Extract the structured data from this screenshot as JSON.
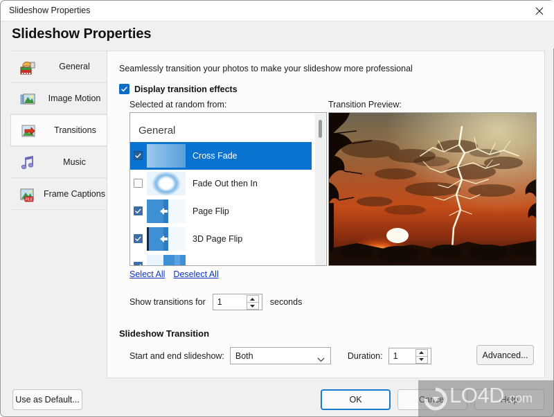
{
  "window": {
    "title": "Slideshow Properties",
    "close_icon": "close-icon"
  },
  "header": {
    "page_title": "Slideshow Properties"
  },
  "sidebar": {
    "items": [
      {
        "label": "General",
        "icon": "camera-film-icon",
        "selected": false
      },
      {
        "label": "Image Motion",
        "icon": "picture-motion-icon",
        "selected": false
      },
      {
        "label": "Transitions",
        "icon": "arrow-picture-icon",
        "selected": true
      },
      {
        "label": "Music",
        "icon": "music-note-icon",
        "selected": false
      },
      {
        "label": "Frame Captions",
        "icon": "picture-file-icon",
        "selected": false
      }
    ]
  },
  "content": {
    "intro_text": "Seamlessly transition your photos to make your slideshow more professional",
    "display_effects": {
      "label": "Display transition effects",
      "checked": true
    },
    "selected_at_random_label": "Selected at random from:",
    "preview_label": "Transition Preview:",
    "list": {
      "group_header": "General",
      "rows": [
        {
          "label": "Cross Fade",
          "checked": true,
          "selected": true,
          "thumb": "cross-fade-thumb"
        },
        {
          "label": "Fade Out then In",
          "checked": false,
          "selected": false,
          "thumb": "fade-out-in-thumb"
        },
        {
          "label": "Page Flip",
          "checked": true,
          "selected": false,
          "thumb": "page-flip-thumb"
        },
        {
          "label": "3D Page Flip",
          "checked": true,
          "selected": false,
          "thumb": "3d-page-flip-thumb"
        },
        {
          "label": "",
          "checked": true,
          "selected": false,
          "thumb": "partial-thumb"
        }
      ]
    },
    "links": {
      "select_all": "Select All",
      "deselect_all": "Deselect All"
    },
    "show_transitions": {
      "label": "Show transitions for",
      "value": "1",
      "unit": "seconds"
    },
    "group": {
      "title": "Slideshow Transition",
      "start_end_label": "Start and end slideshow:",
      "start_end_value": "Both",
      "duration_label": "Duration:",
      "duration_value": "1",
      "advanced_label": "Advanced..."
    }
  },
  "footer": {
    "use_as_default": "Use as Default...",
    "ok": "OK",
    "cancel": "Cancel",
    "help": "Help"
  },
  "watermark": {
    "text": "LO4D",
    "suffix": ".com"
  },
  "colors": {
    "accent": "#0a6cc4",
    "selection": "#0a72cf",
    "link": "#0c34c4",
    "panel": "#fcfcfc",
    "window": "#f0f0f0",
    "default_button_border": "#1a7ad0"
  }
}
